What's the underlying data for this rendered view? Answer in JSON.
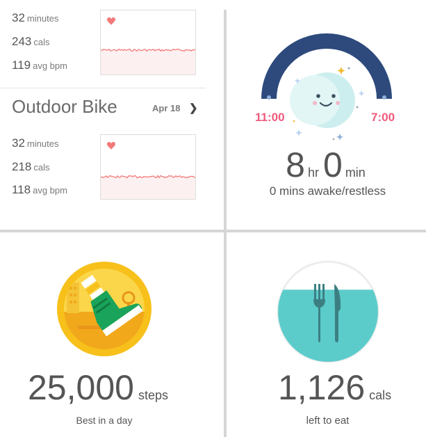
{
  "workouts": [
    {
      "duration_value": "32",
      "duration_unit": "minutes",
      "cals_value": "243",
      "cals_unit": "cals",
      "bpm_value": "119",
      "bpm_unit": "avg bpm"
    },
    {
      "title": "Outdoor Bike",
      "date": "Apr 18",
      "duration_value": "32",
      "duration_unit": "minutes",
      "cals_value": "218",
      "cals_unit": "cals",
      "bpm_value": "118",
      "bpm_unit": "avg bpm"
    }
  ],
  "sleep": {
    "start": "11:00",
    "end": "7:00",
    "hours_value": "8",
    "hours_unit": "hr",
    "mins_value": "0",
    "mins_unit": "min",
    "awake_text": "0 mins awake/restless"
  },
  "steps": {
    "value": "25,000",
    "unit": "steps",
    "caption": "Best in a day"
  },
  "food": {
    "value": "1,126",
    "unit": "cals",
    "caption": "left to eat",
    "fill_level": 0.72
  },
  "icons": {
    "heart": "heart-icon",
    "chevron": "chevron-right-icon",
    "moon": "moon-face-icon",
    "sneaker_badge": "sneaker-badge-icon",
    "cutlery": "fork-knife-icon"
  },
  "colors": {
    "heart_line": "#f27a7a",
    "chart_fill": "#fdf0f0",
    "sleep_arc": "#2e4a7d",
    "sleep_time": "#f05a7e",
    "moon": "#cdeeee",
    "badge_gold": "#f7c01a",
    "sneaker": "#1aa35a",
    "food_fill": "#5ccccb",
    "cutlery": "#3c7f82",
    "divider": "#d6d6d6"
  }
}
